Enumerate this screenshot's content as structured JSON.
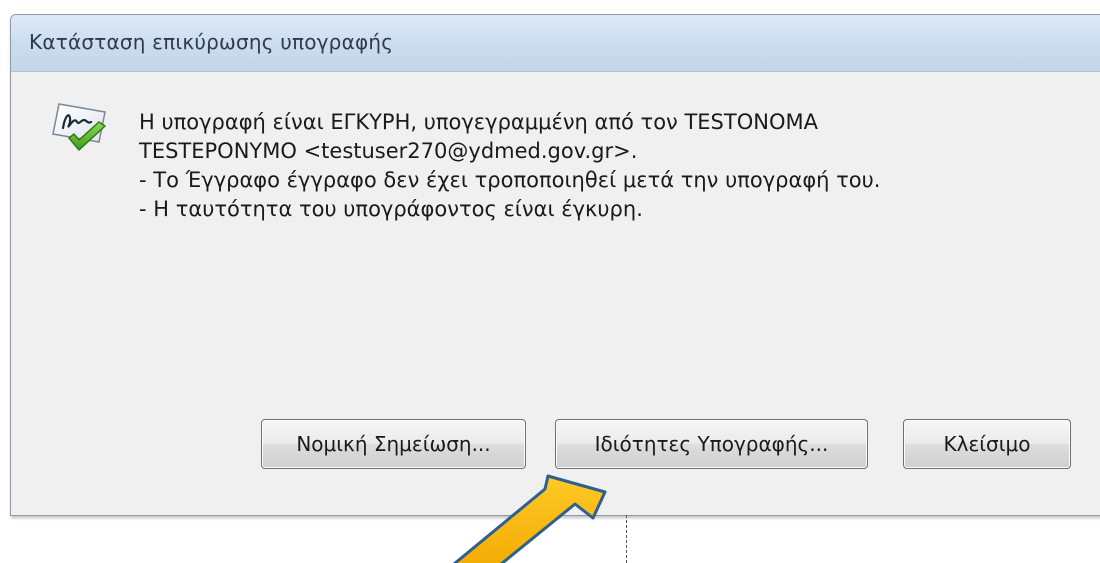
{
  "dialog": {
    "title": "Κατάσταση επικύρωσης υπογραφής",
    "message": {
      "line1": "Η υπογραφή είναι ΕΓΚΥΡΗ, υπογεγραμμένη από τον TESTONOMA",
      "line2": "TESTEPONYMO <testuser270@ydmed.gov.gr>.",
      "line3": "- Το Έγγραφο έγγραφο δεν έχει τροποποιηθεί μετά την υπογραφή του.",
      "line4": "- Η ταυτότητα του υπογράφοντος είναι έγκυρη."
    },
    "buttons": {
      "legal_notice": "Νομική Σημείωση...",
      "signature_properties": "Ιδιότητες Υπογραφής...",
      "close": "Κλείσιμο"
    }
  },
  "icons": {
    "status": "valid-signature-icon",
    "annotation": "pointer-arrow-icon"
  },
  "colors": {
    "checkmark": "#5cb82c",
    "arrow_fill": "#f5b700",
    "arrow_stroke": "#2d5f8f",
    "titlebar": "#cbdcee"
  }
}
